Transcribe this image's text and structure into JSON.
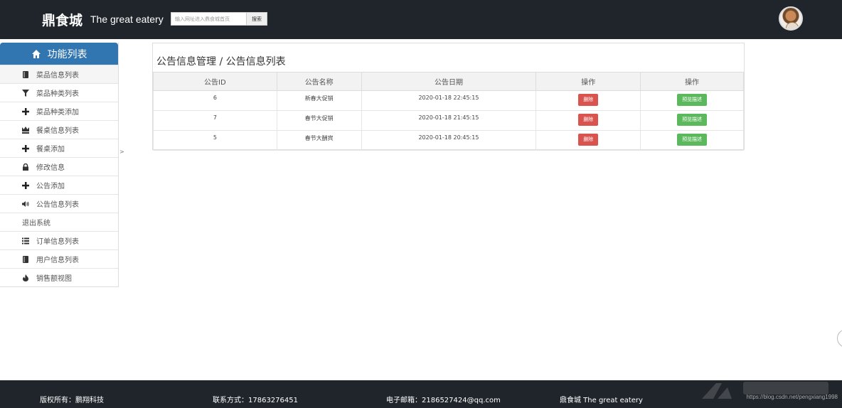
{
  "header": {
    "brand_cn": "鼎食城",
    "brand_en": "The great eatery",
    "search_placeholder": "输入网址进入鼎食城首页",
    "search_button": "搜索"
  },
  "sidebar": {
    "title": "功能列表",
    "items": [
      {
        "label": "菜品信息列表",
        "icon": "book-icon"
      },
      {
        "label": "菜品种类列表",
        "icon": "filter-icon"
      },
      {
        "label": "菜品种类添加",
        "icon": "plus-icon"
      },
      {
        "label": "餐桌信息列表",
        "icon": "crown-icon"
      },
      {
        "label": "餐桌添加",
        "icon": "plus-icon"
      },
      {
        "label": "修改信息",
        "icon": "lock-icon"
      },
      {
        "label": "公告添加",
        "icon": "plus-icon"
      },
      {
        "label": "公告信息列表",
        "icon": "volume-icon"
      },
      {
        "label": "退出系统",
        "icon": ""
      },
      {
        "label": "订单信息列表",
        "icon": "list-icon"
      },
      {
        "label": "用户信息列表",
        "icon": "book-icon"
      },
      {
        "label": "销售额视图",
        "icon": "fire-icon"
      }
    ],
    "toggle": ">"
  },
  "panel": {
    "title": "公告信息管理 / 公告信息列表",
    "columns": [
      "公告ID",
      "公告名称",
      "公告日期",
      "操作",
      "操作"
    ],
    "rows": [
      {
        "id": "6",
        "name": "新春大促销",
        "date": "2020-01-18 22:45:15",
        "delete": "删除",
        "preview": "预览描述"
      },
      {
        "id": "7",
        "name": "春节大促销",
        "date": "2020-01-18 21:45:15",
        "delete": "删除",
        "preview": "预览描述"
      },
      {
        "id": "5",
        "name": "春节大酬宾",
        "date": "2020-01-18 20:45:15",
        "delete": "删除",
        "preview": "预览描述"
      }
    ]
  },
  "footer": {
    "copyright": "版权所有：鹏翔科技",
    "contact": "联系方式：17863276451",
    "email": "电子邮箱：2186527424@qq.com",
    "brand": "鼎食城 The great eatery",
    "watermark": "https://blog.csdn.net/pengxiang1998"
  }
}
